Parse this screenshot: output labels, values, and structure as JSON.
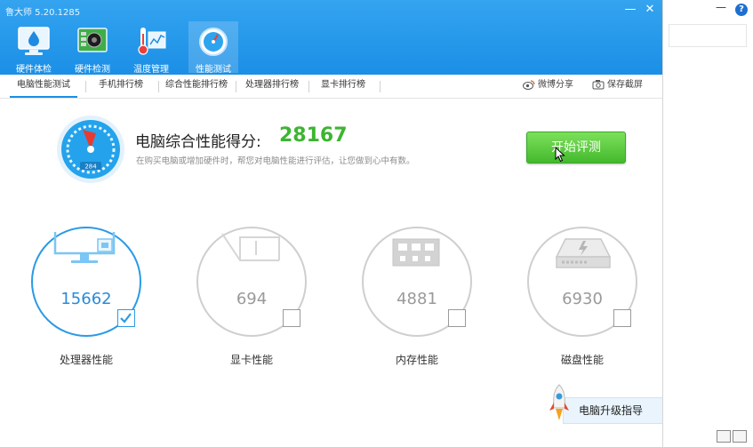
{
  "app": {
    "title": "鲁大师 5.20.1285"
  },
  "window_controls": {
    "minimize": "—",
    "close": "✕"
  },
  "toolbar": {
    "items": [
      {
        "label": "硬件体检",
        "icon": "monitor-drop-icon"
      },
      {
        "label": "硬件检测",
        "icon": "circuit-board-icon"
      },
      {
        "label": "温度管理",
        "icon": "thermometer-chart-icon"
      },
      {
        "label": "性能测试",
        "icon": "speedometer-icon",
        "active": true
      }
    ]
  },
  "tabs": {
    "items": [
      {
        "label": "电脑性能测试",
        "active": true
      },
      {
        "label": "手机排行榜"
      },
      {
        "label": "综合性能排行榜"
      },
      {
        "label": "处理器排行榜"
      },
      {
        "label": "显卡排行榜"
      }
    ],
    "actions": [
      {
        "label": "微博分享",
        "icon": "weibo-icon"
      },
      {
        "label": "保存截屏",
        "icon": "camera-icon"
      }
    ]
  },
  "score": {
    "label": "电脑综合性能得分:",
    "value": "28167",
    "description": "在购买电脑或增加硬件时，帮您对电脑性能进行评估，让您做到心中有数。",
    "gauge_reading": "284",
    "start_button": "开始评测"
  },
  "metrics": [
    {
      "label": "处理器性能",
      "value": "15662",
      "icon": "cpu-monitor-icon",
      "checked": true
    },
    {
      "label": "显卡性能",
      "value": "694",
      "icon": "graphics-card-icon",
      "checked": false
    },
    {
      "label": "内存性能",
      "value": "4881",
      "icon": "memory-chip-icon",
      "checked": false
    },
    {
      "label": "磁盘性能",
      "value": "6930",
      "icon": "hard-disk-icon",
      "checked": false
    }
  ],
  "upgrade_guide": {
    "label": "电脑升级指导",
    "icon": "rocket-icon"
  },
  "outer": {
    "minimize": "—",
    "help": "?"
  },
  "colors": {
    "header": "#1b8fe6",
    "score": "#3cb531",
    "button": "#56c93a",
    "selected": "#2b9ae6"
  }
}
